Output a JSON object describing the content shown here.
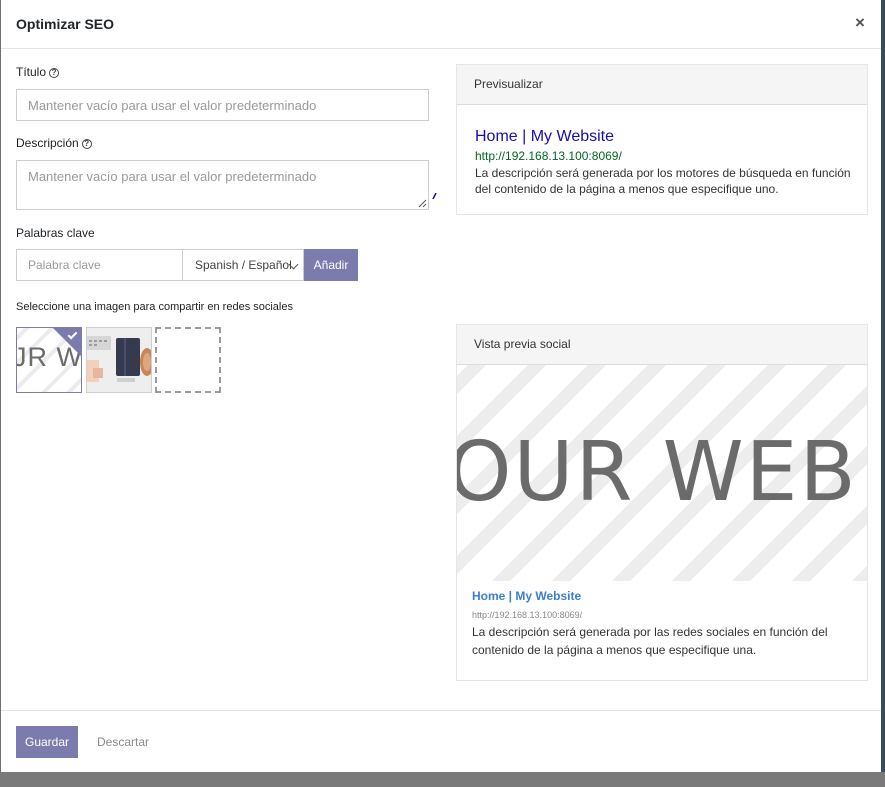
{
  "dialog": {
    "title": "Optimizar SEO",
    "close_glyph": "×"
  },
  "form": {
    "title_label": "Título",
    "title_placeholder": "Mantener vacío para usar el valor predeterminado",
    "description_label": "Descripción",
    "description_placeholder": "Mantener vacío para usar el valor predeterminado",
    "help_glyph": "?",
    "keywords_label": "Palabras clave",
    "keyword_placeholder": "Palabra clave",
    "language_selected": "Spanish / Español",
    "add_button": "Añadir",
    "image_section_label": "Seleccione una imagen para compartir en redes sociales",
    "thumbnail_text": "JR W"
  },
  "preview": {
    "heading": "Previsualizar",
    "title": "Home | My Website",
    "url": "http://192.168.13.100:8069/",
    "description": "La descripción será generada por los motores de búsqueda en función del contenido de la página a menos que especifique uno."
  },
  "social_preview": {
    "heading": "Vista previa social",
    "image_text": "OUR WEB",
    "title": "Home | My Website",
    "url": "http://192.168.13.100:8069/",
    "description": "La descripción será generada por las redes sociales en función del contenido de la página a menos que especifique una."
  },
  "footer": {
    "save_button": "Guardar",
    "discard_button": "Descartar"
  },
  "colors": {
    "accent": "#7c7bad",
    "serp_title": "#1a0dab",
    "serp_url": "#006621",
    "social_title": "#3b7fd1"
  },
  "icons": [
    "close-icon",
    "help-icon",
    "chevron-down-icon",
    "check-icon",
    "resize-grip-icon"
  ]
}
